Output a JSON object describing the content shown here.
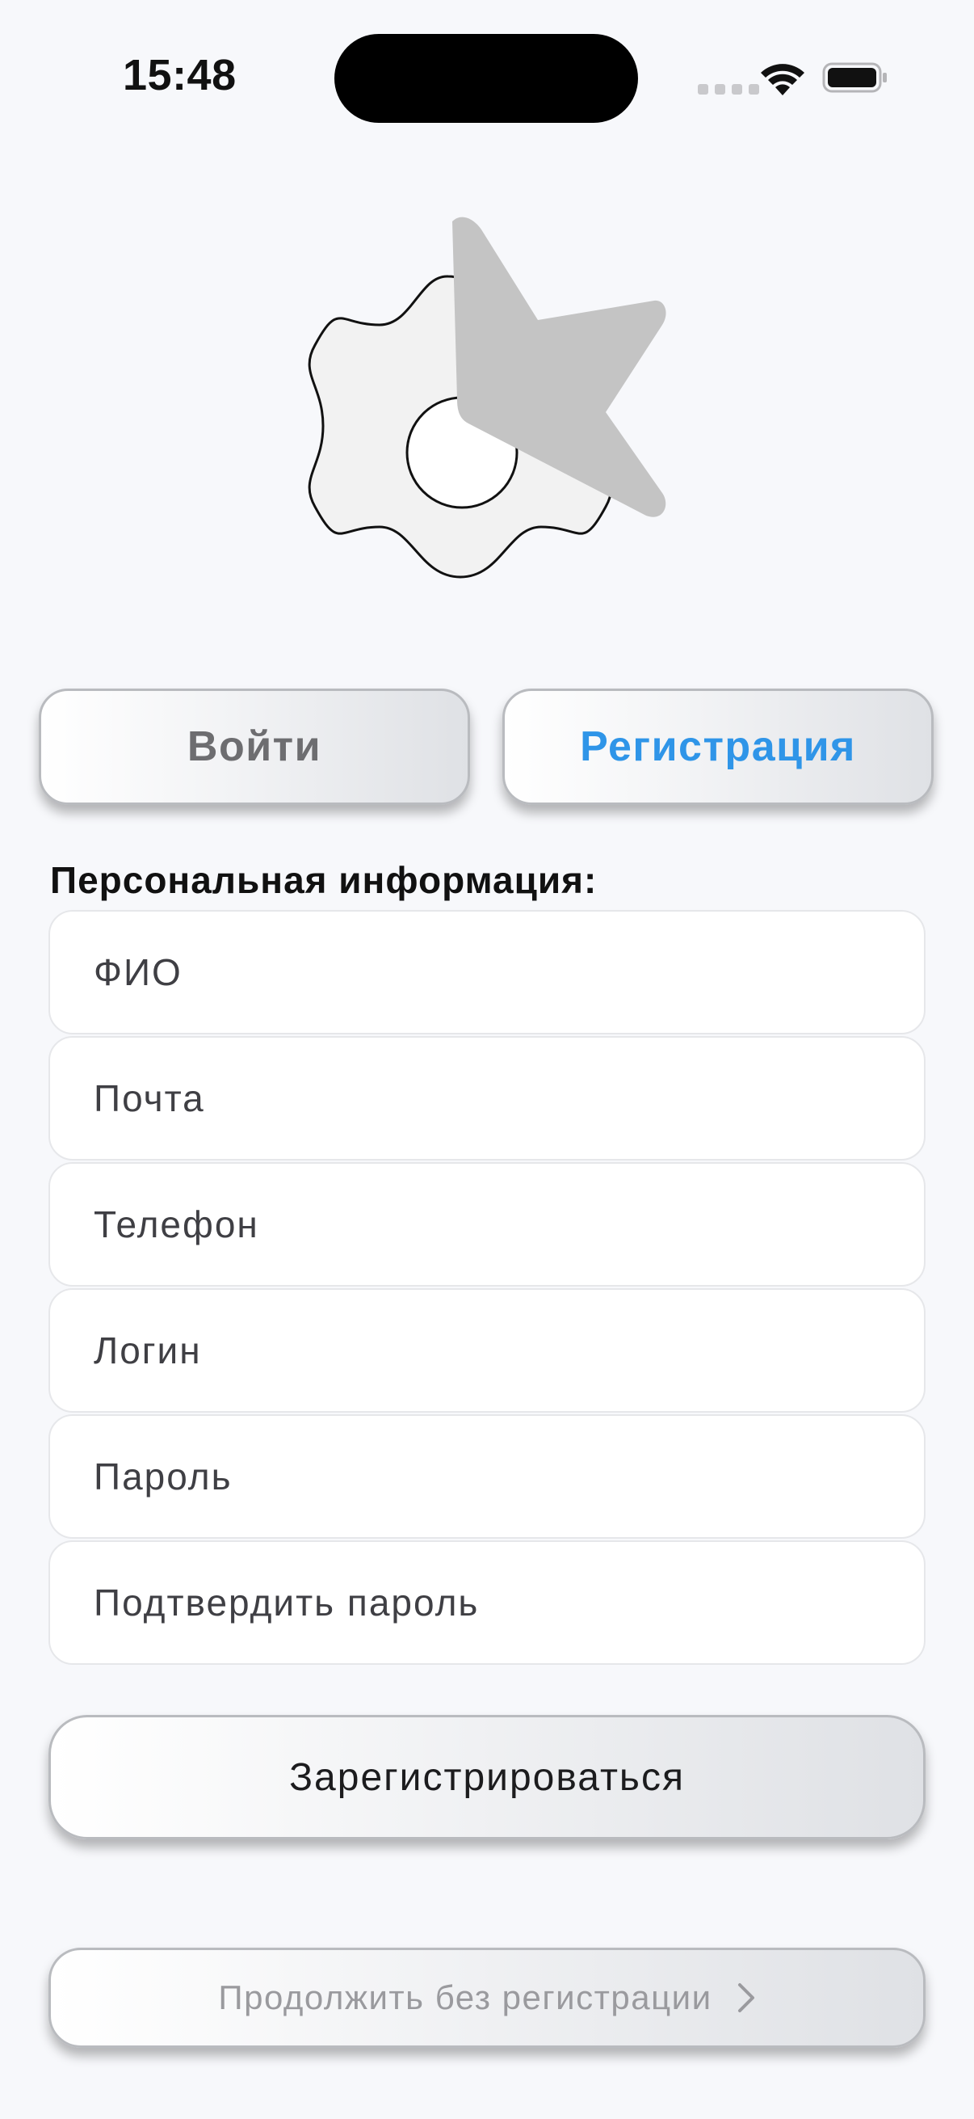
{
  "status_bar": {
    "time": "15:48"
  },
  "logo": {
    "icon": "gear-with-lightning-logo",
    "gear_color": "#f2f2f2",
    "bolt_color": "#c4c4c4"
  },
  "tabs": {
    "login_label": "Войти",
    "register_label": "Регистрация",
    "active": "register",
    "active_color": "#2f95e8",
    "inactive_color": "#6d6d70"
  },
  "form": {
    "section_title": "Персональная информация:",
    "fields": [
      {
        "placeholder": "ФИО"
      },
      {
        "placeholder": "Почта"
      },
      {
        "placeholder": "Телефон"
      },
      {
        "placeholder": "Логин"
      },
      {
        "placeholder": "Пароль"
      },
      {
        "placeholder": "Подтвердить пароль"
      }
    ],
    "submit_label": "Зарегистрироваться"
  },
  "skip": {
    "label": "Продолжить без регистрации"
  }
}
